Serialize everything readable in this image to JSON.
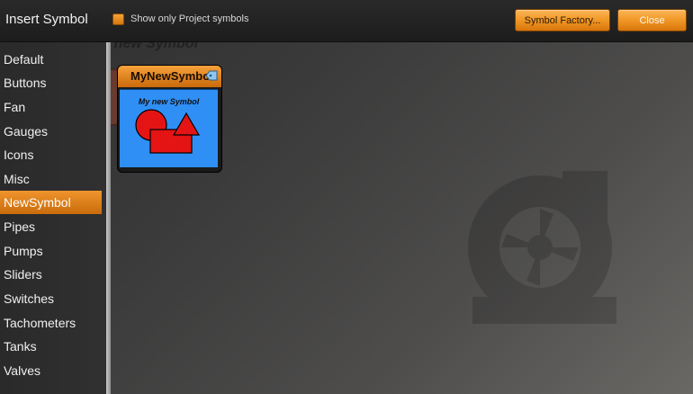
{
  "header": {
    "title": "Insert Symbol",
    "checkbox_label": "Show only Project symbols",
    "checkbox_checked": true,
    "factory_button": "Symbol Factory...",
    "close_button": "Close"
  },
  "sidebar": {
    "categories": [
      {
        "label": "Default"
      },
      {
        "label": "Buttons"
      },
      {
        "label": "Fan"
      },
      {
        "label": "Gauges"
      },
      {
        "label": "Icons"
      },
      {
        "label": "Misc"
      },
      {
        "label": "NewSymbol",
        "selected": true
      },
      {
        "label": "Pipes"
      },
      {
        "label": "Pumps"
      },
      {
        "label": "Sliders"
      },
      {
        "label": "Switches"
      },
      {
        "label": "Tachometers"
      },
      {
        "label": "Tanks"
      },
      {
        "label": "Valves"
      }
    ]
  },
  "background": {
    "ghost_text": "My new Symbol"
  },
  "symbols": [
    {
      "name": "MyNewSymbol",
      "caption": "My new Symbol",
      "icon": "tag-icon"
    }
  ],
  "colors": {
    "accent": "#f29a2a",
    "card_body": "#2f8ff5",
    "shape_fill": "#e51414"
  }
}
